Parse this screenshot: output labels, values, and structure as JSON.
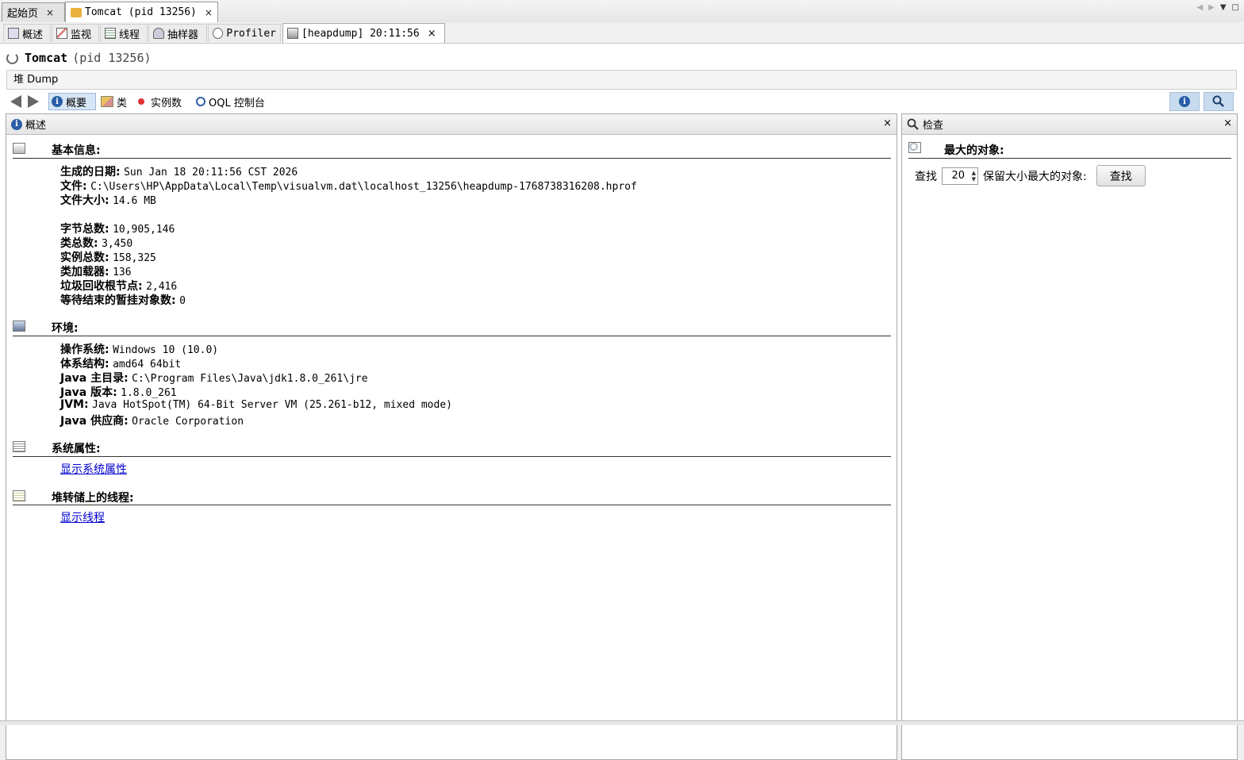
{
  "doc_tabs": [
    {
      "label": "起始页",
      "close": "×"
    },
    {
      "label": "Tomcat (pid 13256)",
      "close": "×"
    }
  ],
  "app_tabs": [
    {
      "label": "概述",
      "icon": "overview-icon"
    },
    {
      "label": "监视",
      "icon": "monitor-icon"
    },
    {
      "label": "线程",
      "icon": "threads-icon"
    },
    {
      "label": "抽样器",
      "icon": "sampler-icon"
    },
    {
      "label": "Profiler",
      "icon": "profiler-icon"
    },
    {
      "label": "[heapdump] 20:11:56",
      "icon": "heapdump-icon",
      "close": "×"
    }
  ],
  "app": {
    "title": "Tomcat",
    "pid": "(pid 13256)"
  },
  "heap_bar": {
    "label": "堆 Dump"
  },
  "toolbar": {
    "summary": "概要",
    "classes": "类",
    "instances": "实例数",
    "oql": "OQL 控制台"
  },
  "left_panel": {
    "title": "概述",
    "close": "×",
    "basic": {
      "title": "基本信息:",
      "rows": [
        {
          "k": "生成的日期:",
          "v": "Sun Jan 18 20:11:56 CST 2026"
        },
        {
          "k": "文件:",
          "v": "C:\\Users\\HP\\AppData\\Local\\Temp\\visualvm.dat\\localhost_13256\\heapdump-1768738316208.hprof"
        },
        {
          "k": "文件大小:",
          "v": "14.6 MB"
        },
        {
          "k": "字节总数:",
          "v": "10,905,146"
        },
        {
          "k": "类总数:",
          "v": "3,450"
        },
        {
          "k": "实例总数:",
          "v": "158,325"
        },
        {
          "k": "类加载器:",
          "v": "136"
        },
        {
          "k": "垃圾回收根节点:",
          "v": "2,416"
        },
        {
          "k": "等待结束的暂挂对象数:",
          "v": "0"
        }
      ]
    },
    "env": {
      "title": "环境:",
      "rows": [
        {
          "k": "操作系统:",
          "v": "Windows 10 (10.0)"
        },
        {
          "k": "体系结构:",
          "v": "amd64 64bit"
        },
        {
          "k": "Java 主目录:",
          "v": "C:\\Program Files\\Java\\jdk1.8.0_261\\jre"
        },
        {
          "k": "Java 版本:",
          "v": "1.8.0_261"
        },
        {
          "k": "JVM:",
          "v": "Java HotSpot(TM) 64-Bit Server VM (25.261-b12, mixed mode)"
        },
        {
          "k": "Java 供应商:",
          "v": "Oracle Corporation"
        }
      ]
    },
    "sysprops": {
      "title": "系统属性:",
      "link": "显示系统属性"
    },
    "threads": {
      "title": "堆转储上的线程:",
      "link": "显示线程"
    }
  },
  "right_panel": {
    "title": "检查",
    "close": "×",
    "section_title": "最大的对象:",
    "find_label": "查找",
    "count": "20",
    "retained_label": "保留大小最大的对象:",
    "find_button": "查找"
  },
  "colors": {
    "link": "#0000cc",
    "selected_bg": "#d7e6f5",
    "info_blue": "#2a5ea8"
  }
}
